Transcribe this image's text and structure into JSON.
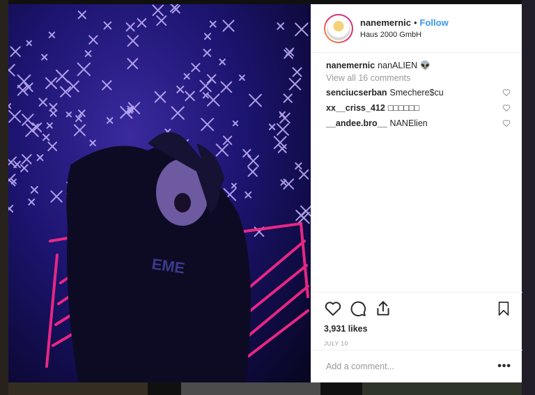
{
  "post": {
    "username": "nanemernic",
    "separator": "•",
    "follow_label": "Follow",
    "location": "Haus 2000 GmbH",
    "caption": {
      "username": "nanemernic",
      "text": "nanALIEN 👽"
    },
    "view_all_label": "View all 16 comments",
    "comments": [
      {
        "username": "senciucserban",
        "text": "Smechere$cu"
      },
      {
        "username": "xx__criss_412",
        "text": "□□□□□□"
      },
      {
        "username": "__andee.bro__",
        "text": "NANElien"
      }
    ],
    "likes": "3,931 likes",
    "date": "July 10",
    "add_comment_placeholder": "Add a comment...",
    "more_label": "•••"
  },
  "icons": {
    "like": "heart-icon",
    "comment": "comment-icon",
    "share": "share-icon",
    "save": "bookmark-icon",
    "comment_like": "heart-icon"
  },
  "colors": {
    "accent": "#3897f0",
    "text": "#262626",
    "muted": "#999999",
    "photo_bg": "#1c1470",
    "neon_pink": "#ff2a8a"
  }
}
